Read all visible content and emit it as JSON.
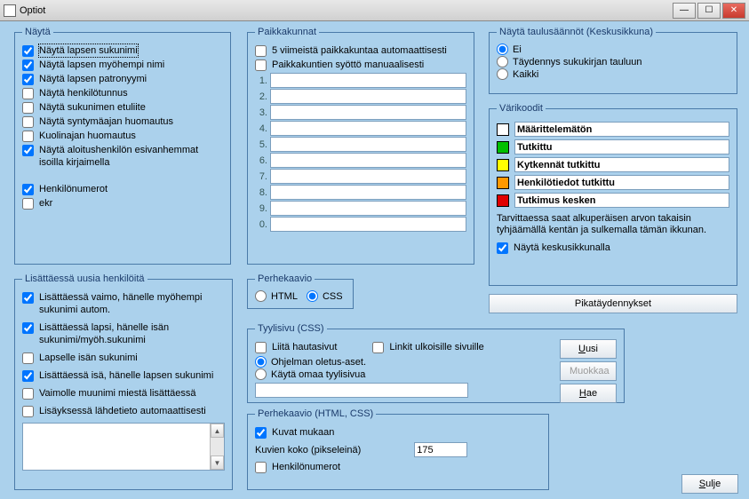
{
  "window": {
    "title": "Optiot"
  },
  "winbtns": {
    "min": "—",
    "max": "☐",
    "close": "✕"
  },
  "nayta": {
    "legend": "Näytä",
    "items": [
      {
        "label": "Näytä lapsen sukunimi",
        "checked": true,
        "sel": true
      },
      {
        "label": "Näytä lapsen myöhempi nimi",
        "checked": true
      },
      {
        "label": "Näytä lapsen patronyymi",
        "checked": true
      },
      {
        "label": "Näytä henkilötunnus",
        "checked": false
      },
      {
        "label": "Näytä sukunimen etuliite",
        "checked": false
      },
      {
        "label": "Näytä syntymäajan huomautus",
        "checked": false
      },
      {
        "label": "Kuolinajan huomautus",
        "checked": false
      },
      {
        "label": "Näytä aloitushenkilön esivanhemmat isoilla kirjaimella",
        "checked": true
      }
    ],
    "extra": [
      {
        "label": "Henkilönumerot",
        "checked": true
      },
      {
        "label": "ekr",
        "checked": false
      }
    ]
  },
  "paikkakunnat": {
    "legend": "Paikkakunnat",
    "top": [
      {
        "label": "5 viimeistä paikkakuntaa automaattisesti",
        "checked": false
      },
      {
        "label": "Paikkakuntien syöttö manuaalisesti",
        "checked": false
      }
    ],
    "nums": [
      "1.",
      "2.",
      "3.",
      "4.",
      "5.",
      "6.",
      "7.",
      "8.",
      "9.",
      "0."
    ]
  },
  "taulu": {
    "legend": "Näytä taulusäännöt (Keskusikkuna)",
    "options": [
      "Ei",
      "Täydennys sukukirjan tauluun",
      "Kaikki"
    ],
    "selected": 0
  },
  "varikoodi": {
    "legend": "Värikoodit",
    "rows": [
      {
        "color": "#FFFFFF",
        "label": "Määrittelemätön"
      },
      {
        "color": "#00C000",
        "label": "Tutkittu"
      },
      {
        "color": "#FFFF00",
        "label": "Kytkennät tutkittu"
      },
      {
        "color": "#FF9900",
        "label": "Henkilötiedot tutkittu"
      },
      {
        "color": "#E00000",
        "label": "Tutkimus kesken"
      }
    ],
    "note": "Tarvittaessa saat alkuperäisen arvon takaisin tyhjäämällä kentän ja sulkemalla tämän ikkunan.",
    "showcenter": "Näytä keskusikkunalla"
  },
  "pikabtn": "Pikatäydennykset",
  "lisat": {
    "legend": "Lisättäessä uusia henkilöitä",
    "items": [
      {
        "label": "Lisättäessä vaimo, hänelle myöhempi sukunimi autom.",
        "checked": true
      },
      {
        "label": "Lisättäessä lapsi, hänelle isän sukunimi/myöh.sukunimi",
        "checked": true
      },
      {
        "label": "Lapselle isän sukunimi",
        "checked": false
      },
      {
        "label": "Lisättäessä isä, hänelle lapsen sukunimi",
        "checked": true
      },
      {
        "label": "Vaimolle muunimi miestä lisättäessä",
        "checked": false
      },
      {
        "label": "Lisäyksessä lähdetieto automaattisesti",
        "checked": false
      }
    ]
  },
  "perhe": {
    "legend": "Perhekaavio",
    "options": [
      "HTML",
      "CSS"
    ],
    "selected": 1
  },
  "tyyli": {
    "legend": "Tyylisivu (CSS)",
    "liita": "Liitä hautasivut",
    "linkit": "Linkit ulkoisille sivuille",
    "options": [
      "Ohjelman oletus-aset.",
      "Käytä omaa tyylisivua"
    ],
    "selected": 0,
    "btns": {
      "uusi": "Uusi",
      "muokkaa": "Muokkaa",
      "hae": "Hae"
    }
  },
  "perhe2": {
    "legend": "Perhekaavio (HTML, CSS)",
    "kuvat": "Kuvat mukaan",
    "koko_label": "Kuvien koko (pikseleinä)",
    "koko_value": "175",
    "henk": "Henkilönumerot"
  },
  "sulje": "Sulje"
}
